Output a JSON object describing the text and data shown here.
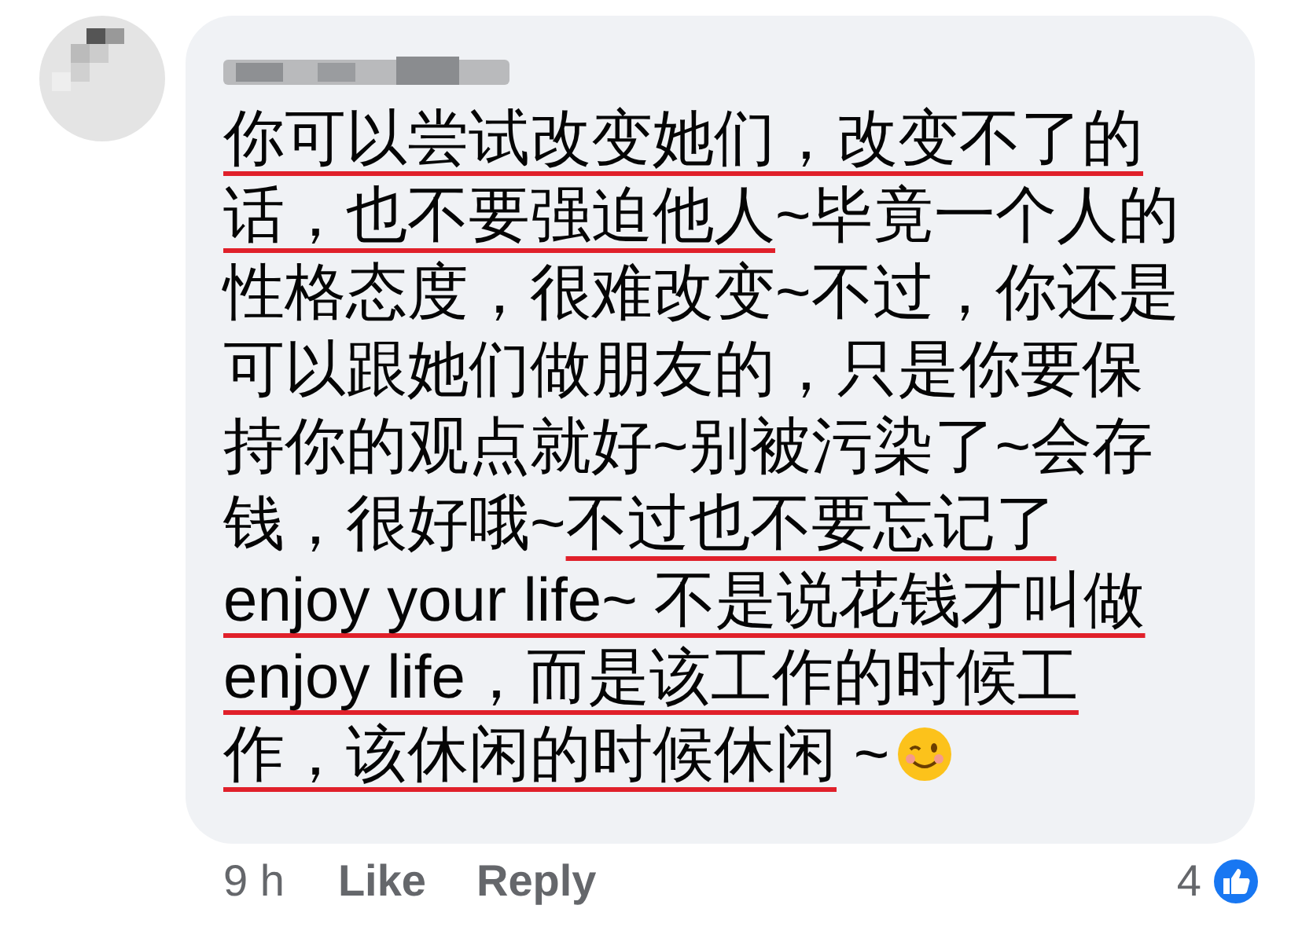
{
  "comment": {
    "segments": [
      {
        "text": "你可以尝试改变她们，改变不了的话，也不要强迫他人",
        "underlined": true
      },
      {
        "text": "~毕竟一个人的性格态度，很难改变~不过，你还是可以跟她们做朋友的，只是你要保持你的观点就好~别被污染了~会存钱，很好哦~",
        "underlined": false
      },
      {
        "text": "不过也不要忘记了 enjoy your life~ 不是说花钱才叫做 enjoy life，而是该工作的时候工作，该休闲的时候休闲",
        "underlined": true
      },
      {
        "text": " ~",
        "underlined": false
      }
    ]
  },
  "footer": {
    "time": "9 h",
    "actions": [
      "Like",
      "Reply"
    ],
    "reaction_count": "4"
  }
}
